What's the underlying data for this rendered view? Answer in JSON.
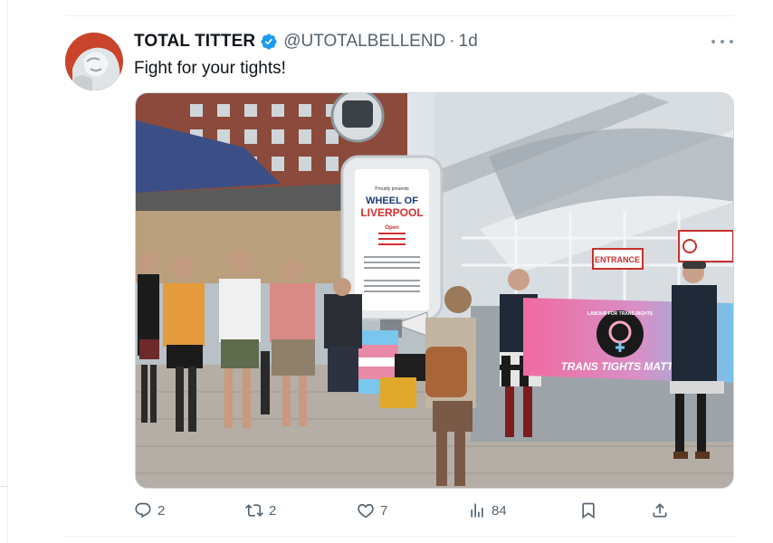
{
  "tweet": {
    "display_name": "TOTAL TITTER",
    "handle": "@UTOTALBELLEND",
    "separator": "·",
    "time": "1d",
    "text": "Fight for your tights!",
    "verified_color": "#1d9bf0"
  },
  "media": {
    "sign": {
      "header": "Proudly presents",
      "title_line1": "WHEEL OF",
      "title_line2": "LIVERPOOL",
      "open_label": "Open"
    },
    "entrance_sign": "ENTRANCE",
    "banner": {
      "org": "LABOUR FOR TRANS RIGHTS",
      "slogan": "TRANS TIGHTS MATTER"
    }
  },
  "actions": {
    "replies": "2",
    "reposts": "2",
    "likes": "7",
    "views": "84"
  },
  "colors": {
    "text_primary": "#0f1419",
    "text_secondary": "#536471",
    "trans_blue": "#7ac6ef",
    "trans_pink": "#e98aa8",
    "sign_red": "#d32f2f"
  }
}
